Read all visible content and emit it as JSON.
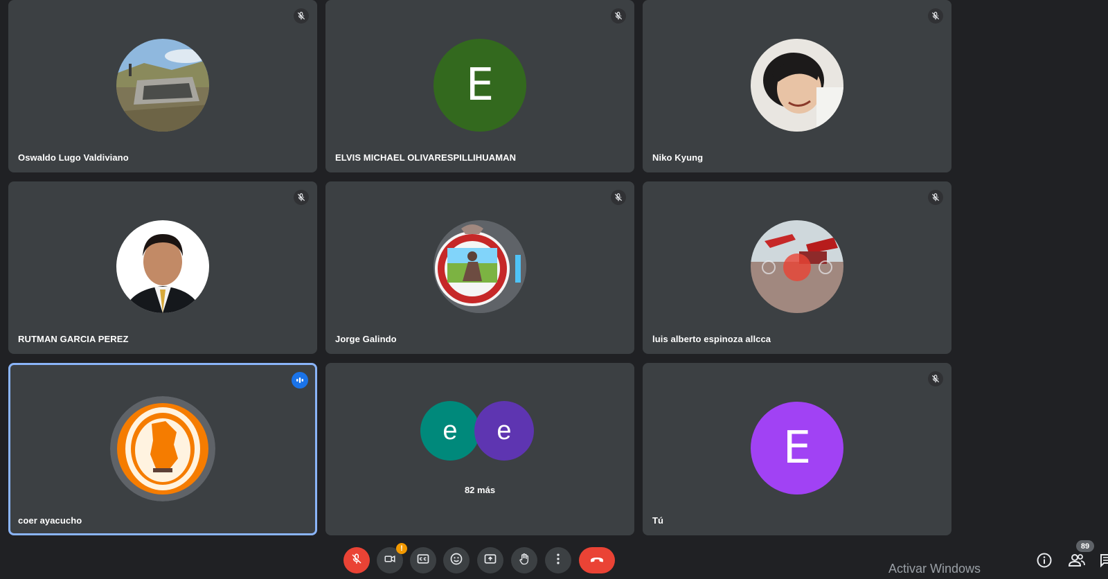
{
  "participants": [
    {
      "name": "Oswaldo Lugo Valdiviano",
      "avatar": "photo-landscape-reservoir",
      "mic": "muted"
    },
    {
      "name": "ELVIS MICHAEL OLIVARESPILLIHUAMAN",
      "avatar_letter": "E",
      "avatar_color": "#33691e",
      "mic": "muted"
    },
    {
      "name": "Niko Kyung",
      "avatar": "photo-person-smiling",
      "mic": "muted"
    },
    {
      "name": "RUTMAN GARCIA PEREZ",
      "avatar": "photo-portrait-suit",
      "mic": "muted"
    },
    {
      "name": "Jorge Galindo",
      "avatar": "emblem-seal",
      "mic": "muted"
    },
    {
      "name": "luis alberto espinoza allcca",
      "avatar": "photo-construction-excavator",
      "mic": "muted"
    },
    {
      "name": "coer ayacucho",
      "avatar": "logo-coer-orange",
      "mic": "speaking"
    },
    {
      "name": "Tú",
      "avatar_letter": "E",
      "avatar_color": "#a142f4",
      "mic": "muted"
    }
  ],
  "overflow_tile": {
    "avatars": [
      {
        "letter": "e",
        "color": "#00897b"
      },
      {
        "letter": "e",
        "color": "#5e35b1"
      }
    ],
    "label": "82 más"
  },
  "toolbar": {
    "buttons": [
      "mic-off-icon",
      "camera-off-icon",
      "captions-icon",
      "emoji-icon",
      "present-icon",
      "raise-hand-icon",
      "more-options-icon",
      "end-call-icon"
    ],
    "camera_warning": "!"
  },
  "side_controls": {
    "info_icon": "info-icon",
    "people_icon": "people-icon",
    "people_count": "89",
    "chat_icon": "chat-icon"
  },
  "watermark": "Activar Windows",
  "colors": {
    "tile_bg": "#3c4043",
    "page_bg": "#202124",
    "speaking_border": "#8ab4f8",
    "danger": "#ea4335"
  }
}
